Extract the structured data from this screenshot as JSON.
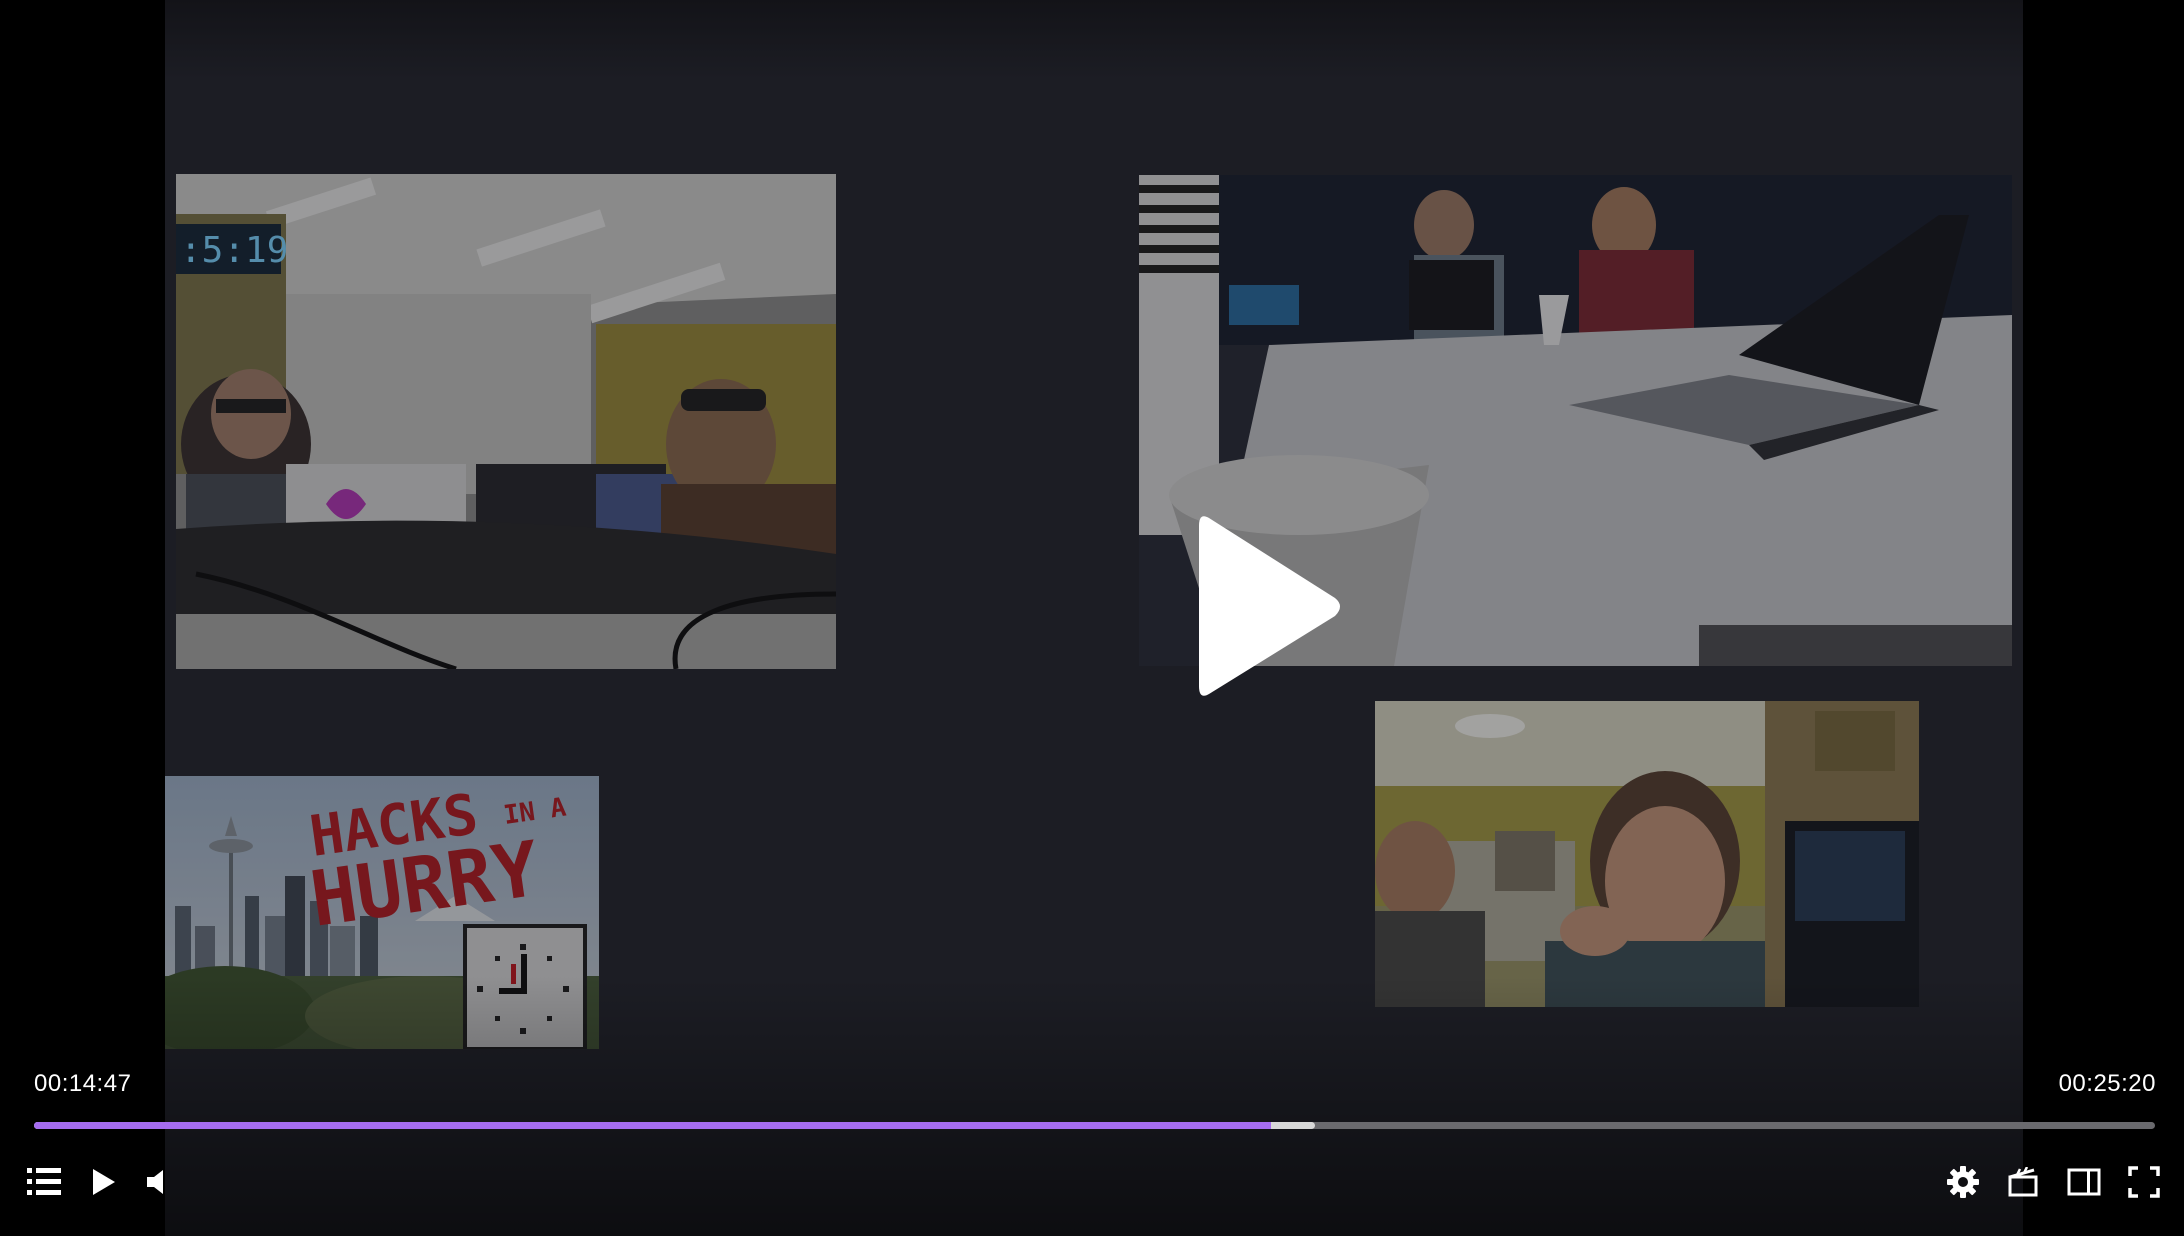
{
  "player": {
    "time_current": "00:14:47",
    "time_total": "00:25:20",
    "progress": {
      "played_fraction": 0.583,
      "buffered_fraction": 0.604
    },
    "colors": {
      "accent": "#a56cf0",
      "buffered": "#d8d8d8",
      "track": "#6a6a6e",
      "background": "#1c1d24"
    },
    "overlay": {
      "center_icon": "play-icon"
    },
    "tiles": [
      {
        "name": "camera-studio",
        "content": "two people at desk with microphones, digital clock on wall"
      },
      {
        "name": "camera-table",
        "content": "people seated around table with laptops and plastic cups"
      },
      {
        "name": "logo-tile",
        "content": "seattle skyline logo with clock"
      },
      {
        "name": "camera-webcam",
        "content": "two people in workshop room"
      }
    ],
    "logo": {
      "line1": "HACKS",
      "line1_small": "IN A",
      "line2": "HURRY"
    },
    "controls": {
      "left": [
        "playlist-icon",
        "play-icon",
        "volume-icon"
      ],
      "right": [
        "gear-icon",
        "clapperboard-icon",
        "theater-mode-icon",
        "fullscreen-icon"
      ]
    }
  }
}
